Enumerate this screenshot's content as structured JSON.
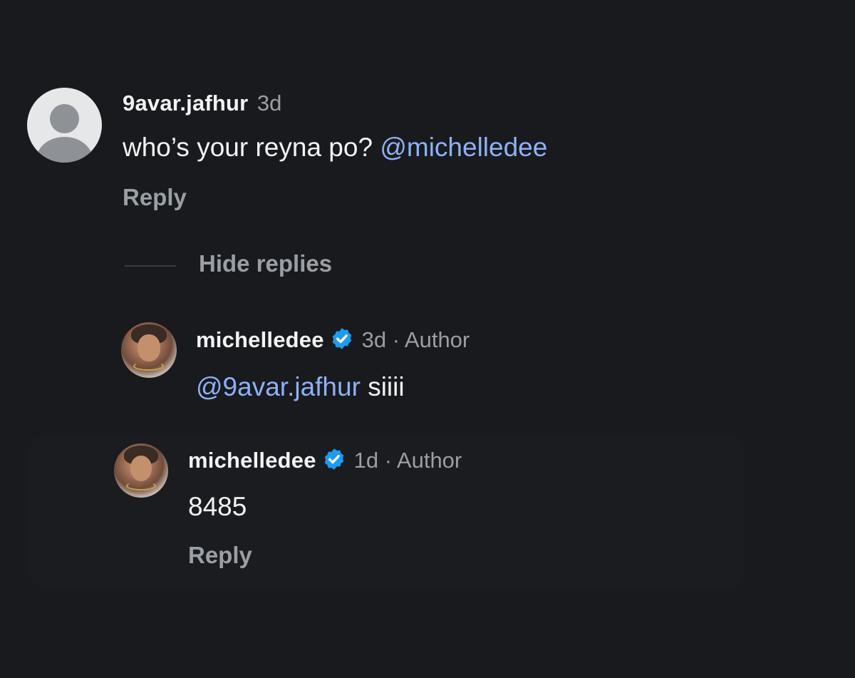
{
  "comment": {
    "username": "9avar.jafhur",
    "time": "3d",
    "text": "who’s your reyna po? ",
    "mention": "@michelledee",
    "reply_label": "Reply",
    "avatar_icon": "default-user-avatar-icon"
  },
  "replies_toggle": {
    "label": "Hide replies"
  },
  "replies": [
    {
      "username": "michelledee",
      "verified": true,
      "meta": "3d · Author",
      "mention": "@9avar.jafhur",
      "text": " siiii",
      "reply_label": ""
    },
    {
      "username": "michelledee",
      "verified": true,
      "meta": "1d · Author",
      "mention": "",
      "text": "8485",
      "reply_label": "Reply"
    }
  ],
  "colors": {
    "background": "#181a1d",
    "mention": "#8fb0f5",
    "verified": "#1d9bf0",
    "muted": "#9a9ea5"
  }
}
